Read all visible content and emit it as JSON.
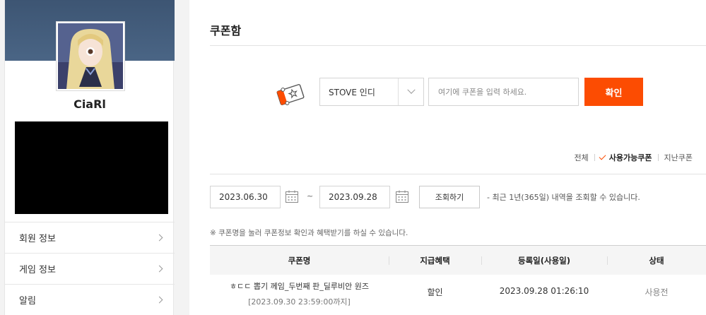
{
  "profile": {
    "username": "CiaRl"
  },
  "menu": [
    {
      "label": "회원 정보"
    },
    {
      "label": "게임 정보"
    },
    {
      "label": "알림"
    }
  ],
  "page": {
    "title": "쿠폰함"
  },
  "coupon_form": {
    "store_select": "STOVE 인디",
    "placeholder": "여기에 쿠폰을 입력 하세요.",
    "confirm_label": "확인"
  },
  "filters": {
    "all": "전체",
    "available": "사용가능쿠폰",
    "past": "지난쿠폰"
  },
  "search": {
    "start_date": "2023.06.30",
    "tilde": "~",
    "end_date": "2023.09.28",
    "button_label": "조회하기",
    "note": "- 최근 1년(365일) 내역을 조회할 수 있습니다."
  },
  "notice": "※ 쿠폰명을 눌러 쿠폰정보 확인과 혜택받기를 하실 수 있습니다.",
  "table": {
    "headers": [
      "쿠폰명",
      "지급혜택",
      "등록일(사용일)",
      "상태"
    ],
    "rows": [
      {
        "name": "ㅎㄷㄷ 뽑기 께임_두번째 판_딜루비안 원즈",
        "until": "[2023.09.30 23:59:00까지]",
        "benefit": "할인",
        "registered": "2023.09.28 01:26:10",
        "status": "사용전"
      }
    ]
  },
  "colors": {
    "accent": "#fc4c02",
    "banner": "#3d5573"
  },
  "icons": [
    "ticket-icon",
    "chevron-down-icon",
    "chevron-right-icon",
    "check-icon",
    "calendar-icon"
  ]
}
